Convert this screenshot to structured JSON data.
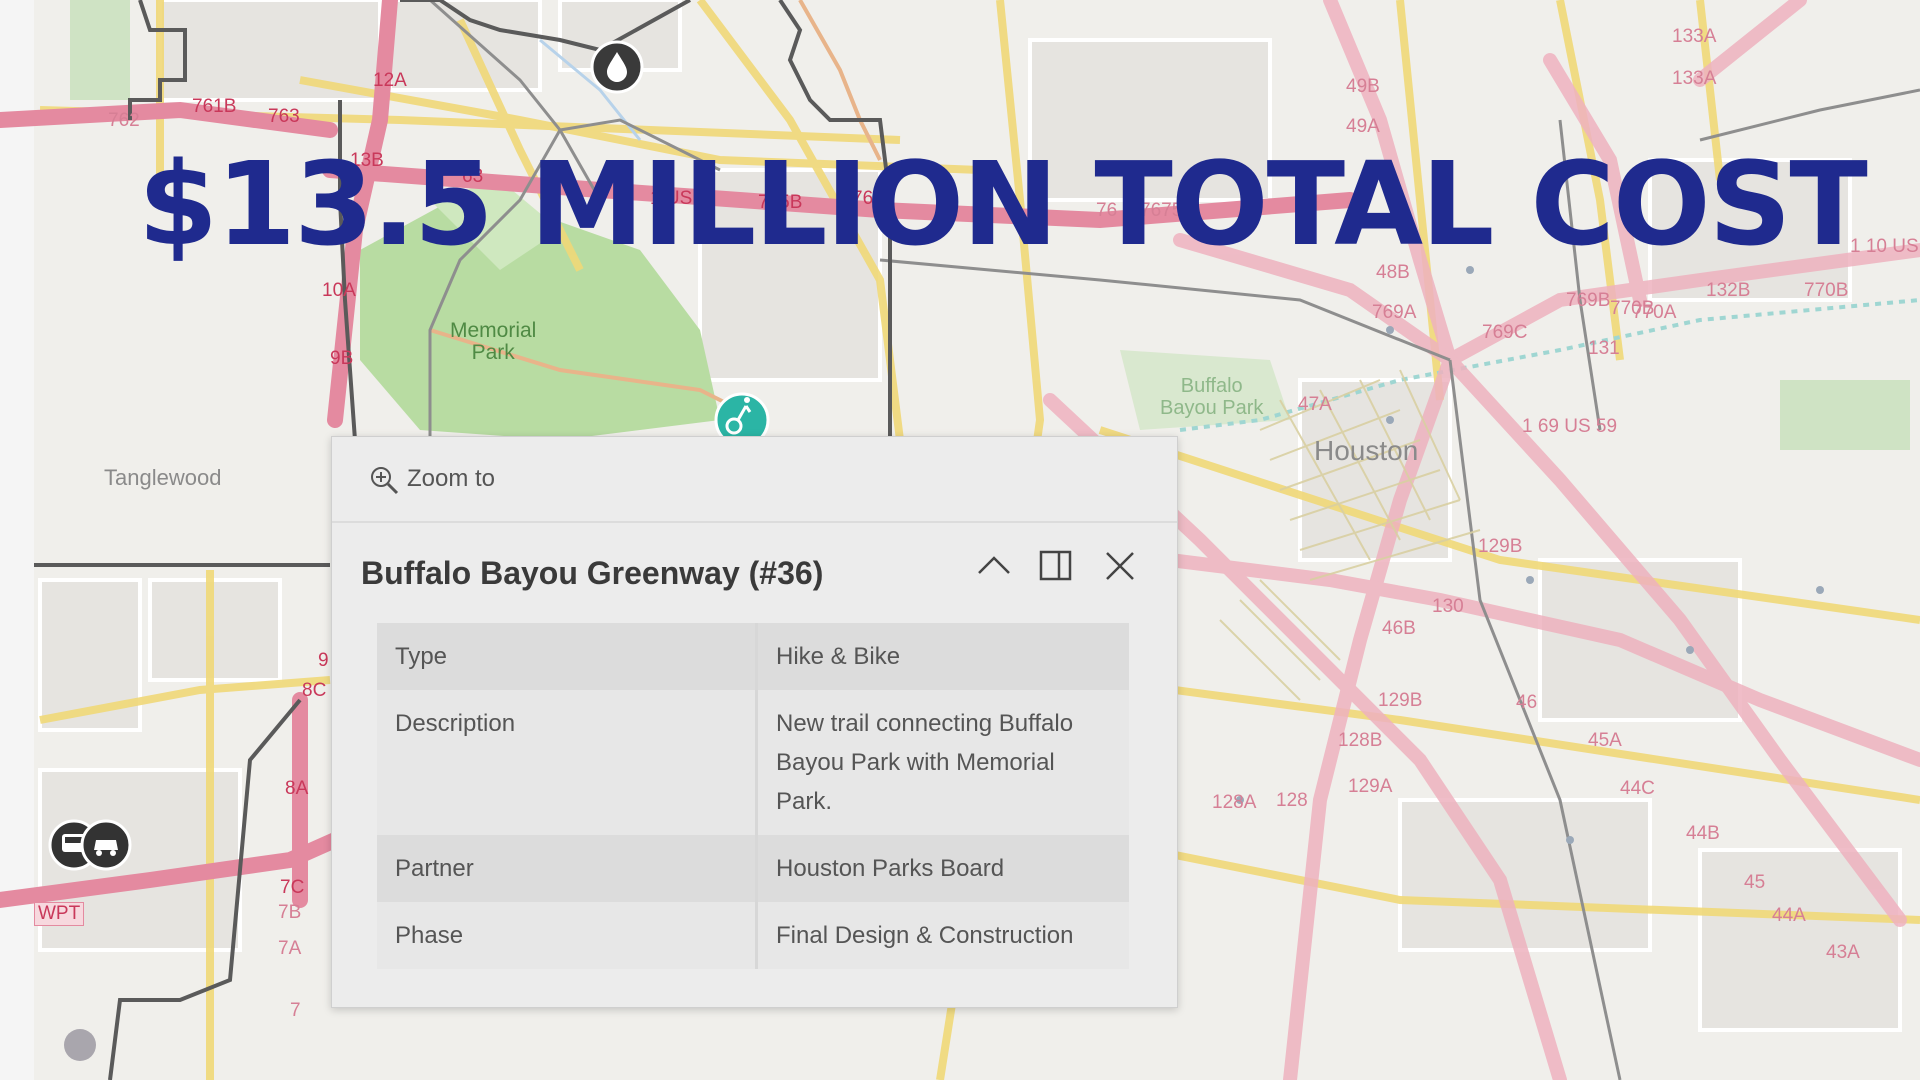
{
  "headline": "$13.5 MILLION TOTAL COST",
  "colors": {
    "headline": "#1f2a8e",
    "highway": "#e48aa0",
    "arterial": "#f0d878",
    "park": "#b8dca2",
    "marker": "#2bb5a5"
  },
  "map": {
    "places": [
      "Tanglewood",
      "Houston"
    ],
    "parks": [
      {
        "line1": "Memorial",
        "line2": "Park"
      },
      {
        "line1": "Buffalo",
        "line2": "Bayou Park"
      }
    ],
    "exits": [
      "12A",
      "761B",
      "763",
      "762",
      "13B",
      "63",
      "1 US 9",
      "765B",
      "765",
      "10A",
      "9B",
      "9",
      "8C",
      "8A",
      "7C",
      "7B",
      "7A",
      "7",
      "WPT",
      "49B",
      "49A",
      "48B",
      "47A",
      "46B",
      "769A",
      "769C",
      "769B",
      "770B",
      "770A",
      "770B",
      "133A",
      "133A",
      "132B",
      "131",
      "1 10 US",
      "1 69 US 59",
      "129B",
      "130",
      "129B",
      "128B",
      "128A",
      "128",
      "129A",
      "46",
      "45A",
      "44C",
      "44B",
      "45",
      "44A",
      "43A",
      "7675",
      "76"
    ],
    "icons": [
      "water-drop-icon",
      "hike-bike-icon",
      "bus-icon",
      "car-icon"
    ]
  },
  "popup": {
    "zoom_label": "Zoom to",
    "title": "Buffalo Bayou Greenway (#36)",
    "controls": [
      "collapse-icon",
      "dock-icon",
      "close-icon"
    ],
    "fields": [
      {
        "key": "Type",
        "value": "Hike & Bike"
      },
      {
        "key": "Description",
        "value": "New trail connecting Buffalo Bayou Park with Memorial Park."
      },
      {
        "key": "Partner",
        "value": "Houston Parks Board"
      },
      {
        "key": "Phase",
        "value": "Final Design & Construction"
      }
    ]
  }
}
